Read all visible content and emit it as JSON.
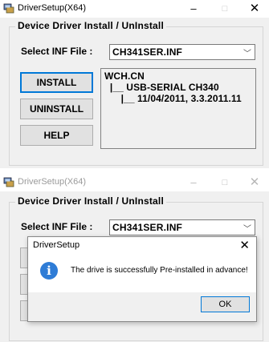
{
  "window1": {
    "title": "DriverSetup(X64)",
    "controls": {
      "minimize": "–",
      "maximize": "□",
      "close": "✕"
    },
    "group_title": "Device Driver Install / UnInstall",
    "inf_label": "Select INF File :",
    "inf_value": "CH341SER.INF",
    "buttons": {
      "install": "INSTALL",
      "uninstall": "UNINSTALL",
      "help": "HELP"
    },
    "info_lines": [
      "WCH.CN",
      "  |__ USB-SERIAL CH340",
      "      |__ 11/04/2011, 3.3.2011.11"
    ]
  },
  "window2": {
    "title": "DriverSetup(X64)",
    "controls": {
      "minimize": "–",
      "maximize": "□",
      "close": "✕"
    },
    "group_title": "Device Driver Install / UnInstall",
    "inf_label": "Select INF File :",
    "inf_value": "CH341SER.INF"
  },
  "dialog": {
    "title": "DriverSetup",
    "close": "✕",
    "icon": "info-icon",
    "icon_glyph": "i",
    "message": "The drive is successfully Pre-installed in advance!",
    "ok": "OK"
  },
  "colors": {
    "accent": "#0078d7",
    "info_icon": "#2e7cd6",
    "window_bg": "#f0f0f0"
  }
}
